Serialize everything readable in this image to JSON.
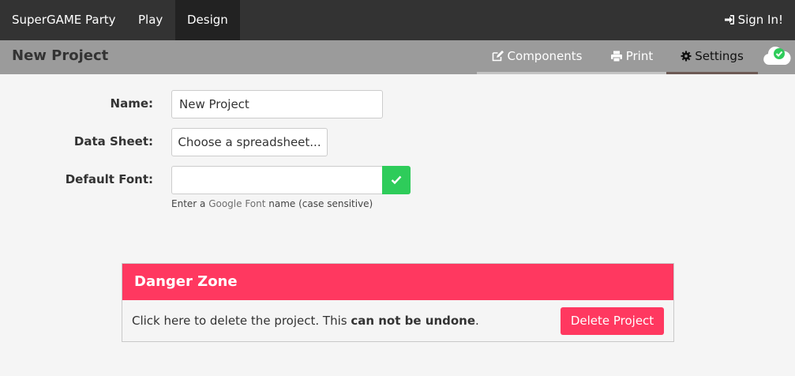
{
  "navbar": {
    "brand": "SuperGAME Party",
    "items": [
      {
        "label": "Play"
      },
      {
        "label": "Design"
      }
    ],
    "sign_in": "Sign In!"
  },
  "subheader": {
    "project_title": "New Project",
    "tabs": [
      {
        "label": "Components",
        "icon": "edit-icon"
      },
      {
        "label": "Print",
        "icon": "print-icon"
      },
      {
        "label": "Settings",
        "icon": "gear-icon",
        "active": true
      }
    ],
    "sync_icon": "cloud-check-icon"
  },
  "form": {
    "name_label": "Name:",
    "name_value": "New Project",
    "sheet_label": "Data Sheet:",
    "sheet_button": "Choose a spreadsheet...",
    "font_label": "Default Font:",
    "font_value": "",
    "help_prefix": "Enter a ",
    "help_link": "Google Font",
    "help_suffix": " name (case sensitive)"
  },
  "danger_zone": {
    "title": "Danger Zone",
    "text_prefix": "Click here to delete the project. This ",
    "text_bold": "can not be undone",
    "text_suffix": ".",
    "delete_button": "Delete Project"
  },
  "colors": {
    "navbar": "#333333",
    "active_nav": "#222222",
    "subheader": "#9b9b9b",
    "danger": "#ff3860",
    "success": "#2ecc5a"
  }
}
